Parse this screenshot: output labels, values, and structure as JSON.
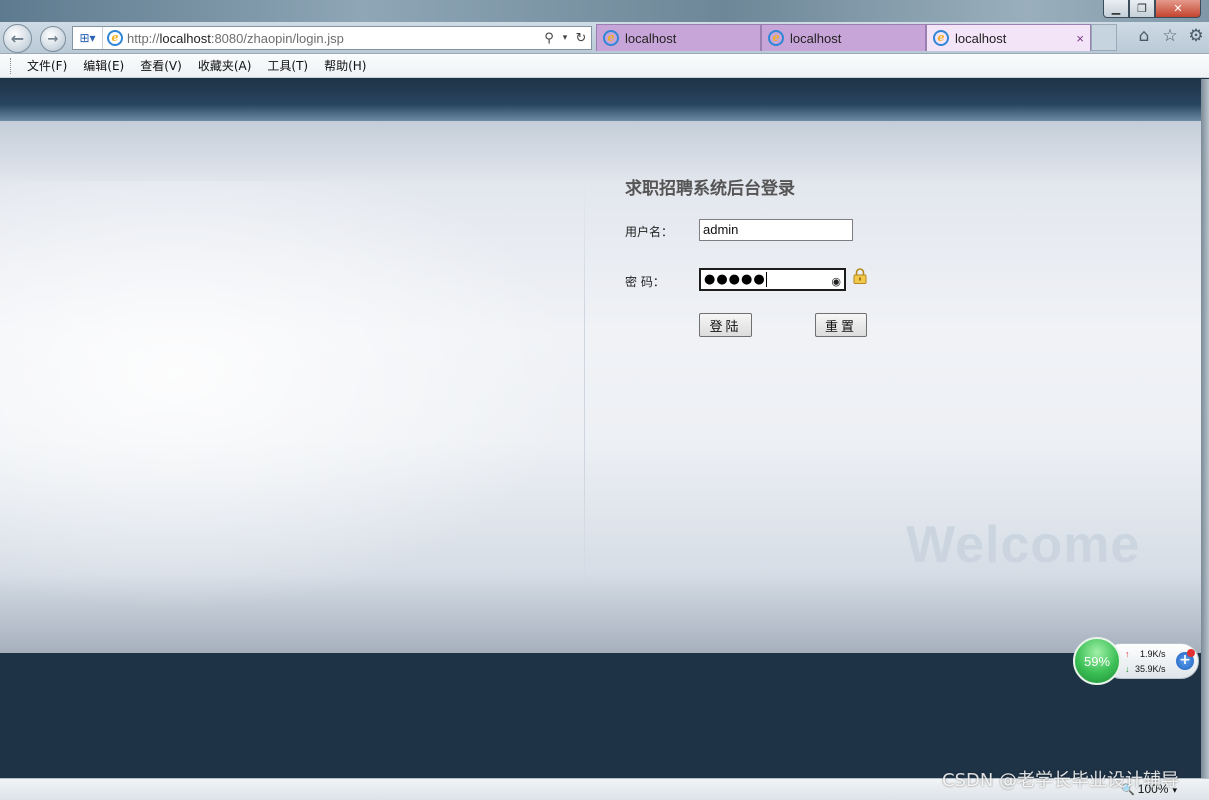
{
  "browser": {
    "address_prefix": "http://",
    "address_host": "localhost",
    "address_rest": ":8080/zhaopin/login.jsp",
    "tabs": [
      {
        "label": "localhost"
      },
      {
        "label": "localhost"
      },
      {
        "label": "localhost"
      }
    ],
    "menu": {
      "file": "文件(F)",
      "edit": "编辑(E)",
      "view": "查看(V)",
      "favorites": "收藏夹(A)",
      "tools": "工具(T)",
      "help": "帮助(H)"
    },
    "zoom": "100%",
    "tab_close_glyph": "×"
  },
  "login": {
    "title": "求职招聘系统后台登录",
    "username_label": "用户名：",
    "username_value": "admin",
    "password_label": "密 码：",
    "password_mask": "●●●●●",
    "login_button": "登陆",
    "reset_button": "重置",
    "welcome_text": "Welcome"
  },
  "speed_widget": {
    "percent": "59%",
    "upload": "1.9K/s",
    "download": "35.9K/s"
  },
  "watermark": "CSDN @老学长毕业设计辅导",
  "colors": {
    "page_dark": "#1f3347",
    "tab_inactive": "#c8a5d8",
    "tab_active": "#f3e4f7"
  }
}
